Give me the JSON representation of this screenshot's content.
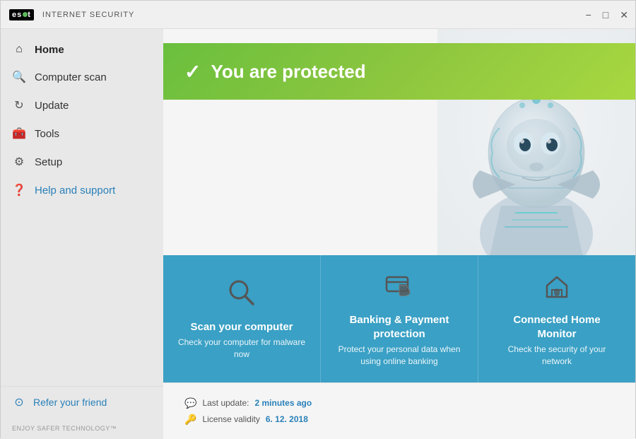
{
  "titlebar": {
    "logo_text": "eset",
    "app_name": "INTERNET SECURITY",
    "minimize_label": "−",
    "maximize_label": "□",
    "close_label": "✕"
  },
  "sidebar": {
    "items": [
      {
        "id": "home",
        "label": "Home",
        "icon": "home",
        "active": true
      },
      {
        "id": "computer-scan",
        "label": "Computer scan",
        "icon": "search",
        "active": false
      },
      {
        "id": "update",
        "label": "Update",
        "icon": "refresh",
        "active": false
      },
      {
        "id": "tools",
        "label": "Tools",
        "icon": "briefcase",
        "active": false
      },
      {
        "id": "setup",
        "label": "Setup",
        "icon": "gear",
        "active": false
      },
      {
        "id": "help-support",
        "label": "Help and support",
        "icon": "help-circle",
        "active": false
      }
    ],
    "refer_label": "Refer your friend",
    "tagline": "ENJOY SAFER TECHNOLOGY™"
  },
  "content": {
    "protected_text": "You are protected",
    "feature_cards": [
      {
        "id": "scan",
        "title": "Scan your computer",
        "description": "Check your computer for malware now",
        "icon": "magnify"
      },
      {
        "id": "banking",
        "title": "Banking & Payment protection",
        "description": "Protect your personal data when using online banking",
        "icon": "card-shield"
      },
      {
        "id": "home-monitor",
        "title": "Connected Home Monitor",
        "description": "Check the security of your network",
        "icon": "home-shield"
      }
    ]
  },
  "statusbar": {
    "last_update_label": "Last update:",
    "last_update_value": "2 minutes ago",
    "license_label": "License validity",
    "license_value": "6. 12. 2018"
  }
}
